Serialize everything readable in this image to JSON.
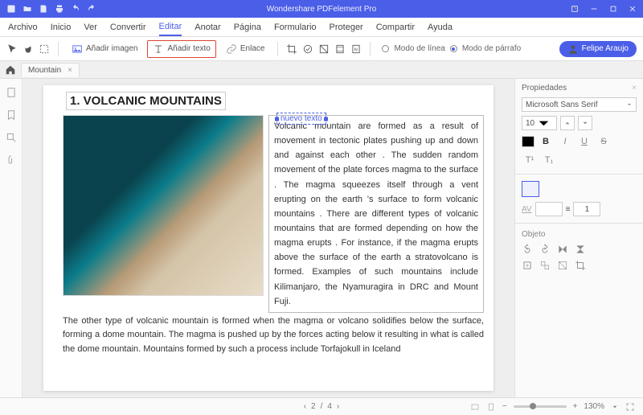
{
  "app": {
    "title": "Wondershare PDFelement Pro"
  },
  "menu": {
    "items": [
      "Archivo",
      "Inicio",
      "Ver",
      "Convertir",
      "Editar",
      "Anotar",
      "Página",
      "Formulario",
      "Proteger",
      "Compartir",
      "Ayuda"
    ],
    "active": 4
  },
  "toolbar": {
    "add_image": "Añadir imagen",
    "add_text": "Añadir texto",
    "link": "Enlace",
    "mode_line": "Modo de línea",
    "mode_para": "Modo de párrafo",
    "user": "Felipe Araujo"
  },
  "tab": {
    "name": "Mountain"
  },
  "doc": {
    "heading": "1. VOLCANIC MOUNTAINS",
    "new_text_placeholder": "nuevo texto",
    "paragraph_right": "Volcanic mountain are formed as a result of movement in tectonic plates pushing up and down and against each other . The sudden random movement of the plate forces magma to the surface . The magma squeezes itself through a vent erupting on the earth 's\nsurface to form volcanic mountains . There are different types of volcanic mountains that are formed depending on how the magma erupts . For instance, if the magma erupts\nabove the surface of the earth a stratovolcano is formed. Examples of such mountains include Kilimanjaro, the Nyamuragira in DRC and Mount Fuji.",
    "paragraph_lower": "The other type of volcanic mountain is formed when the magma or volcano solidifies below the surface, forming a dome mountain. The magma is pushed up by the forces acting below it resulting in what is called the dome mountain. Mountains formed by such a process include Torfajokull in Iceland"
  },
  "props": {
    "title": "Propiedades",
    "font_family": "Microsoft Sans Serif",
    "font_size": "10",
    "object_label": "Objeto",
    "spacing_value": "1"
  },
  "status": {
    "page_current": "2",
    "page_total": "4",
    "zoom": "130%"
  }
}
